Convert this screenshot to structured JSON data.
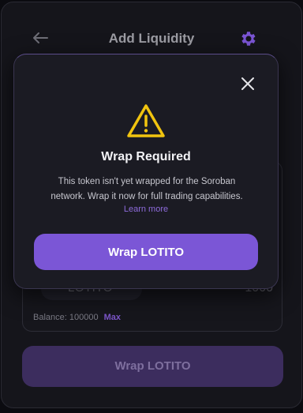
{
  "header": {
    "title": "Add Liquidity",
    "back_icon": "arrow-left-icon",
    "settings_icon": "gear-icon"
  },
  "background_form": {
    "token_label": "LOTITO",
    "amount_value": "1000",
    "balance_label": "Balance: 100000",
    "max_label": "Max",
    "wrap_button_label": "Wrap LOTITO"
  },
  "modal": {
    "close_icon": "close-icon",
    "warning_icon": "warning-triangle-icon",
    "title": "Wrap Required",
    "description": "This token isn't yet wrapped for the Soroban network. Wrap it now for full trading capabilities.",
    "learn_more_label": "Learn more",
    "wrap_button_label": "Wrap LOTITO"
  },
  "colors": {
    "accent": "#7b56d6",
    "warning": "#f1c40f",
    "gear": "#7b55d4",
    "background": "#0b0b10"
  }
}
